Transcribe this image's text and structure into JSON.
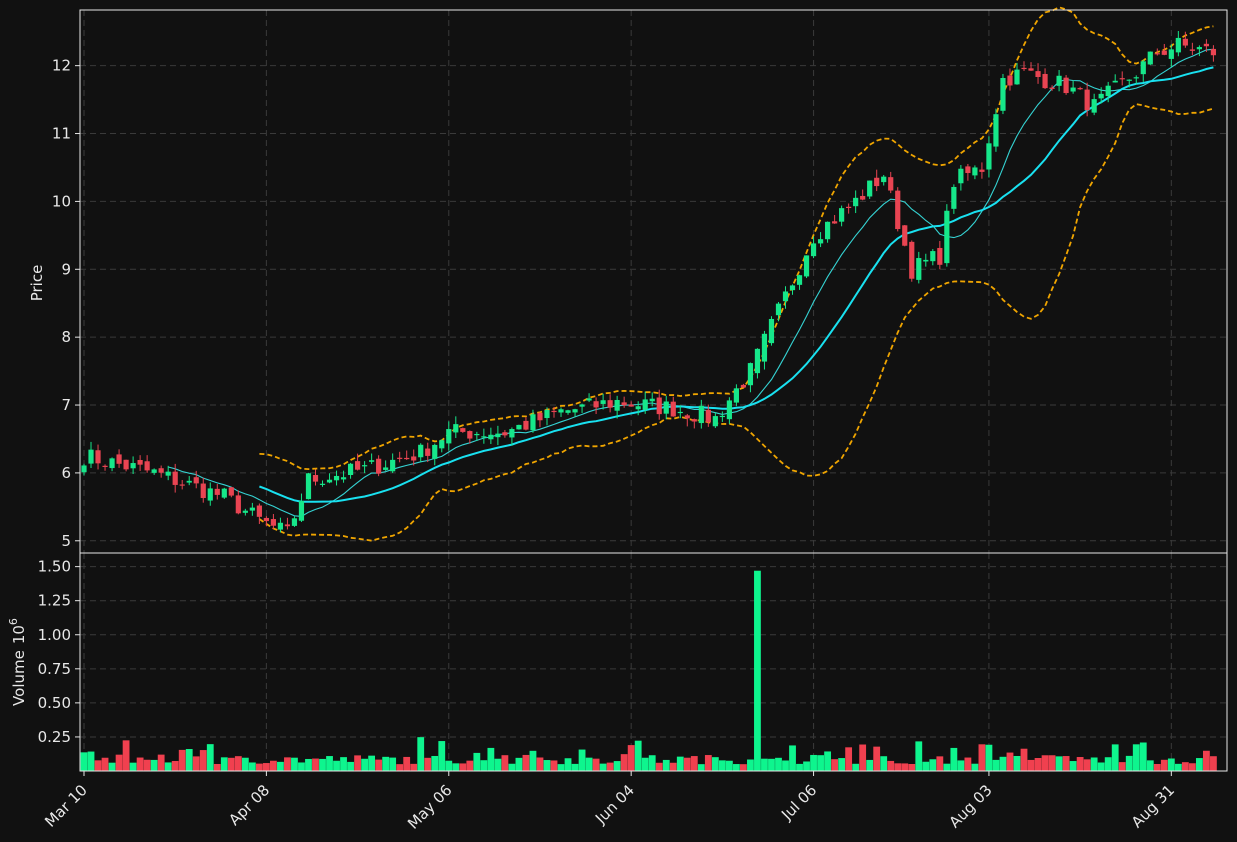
{
  "chart_data": {
    "type": "candlestick",
    "n_bars": 162,
    "x_ticks": [
      {
        "index": 0,
        "label": "Mar 10"
      },
      {
        "index": 26,
        "label": "Apr 08"
      },
      {
        "index": 52,
        "label": "May 06"
      },
      {
        "index": 78,
        "label": "Jun 04"
      },
      {
        "index": 104,
        "label": "Jul 06"
      },
      {
        "index": 129,
        "label": "Aug 03"
      },
      {
        "index": 155,
        "label": "Aug 31"
      }
    ],
    "price_panel": {
      "ylabel": "Price",
      "ylim": [
        4.82,
        12.82
      ],
      "yticks": [
        5,
        6,
        7,
        8,
        9,
        10,
        11,
        12
      ]
    },
    "volume_panel": {
      "ylabel": "Volume",
      "yunit": "10",
      "yunit_exp": "6",
      "ylim": [
        0,
        1.6
      ],
      "yticks": [
        0.25,
        0.5,
        0.75,
        1.0,
        1.25,
        1.5
      ],
      "ytick_labels": [
        "0.25",
        "0.50",
        "0.75",
        "1.00",
        "1.25",
        "1.50"
      ]
    },
    "price_anchors": [
      [
        0,
        6.25
      ],
      [
        10,
        6.0
      ],
      [
        20,
        5.65
      ],
      [
        25,
        5.3
      ],
      [
        29,
        5.1
      ],
      [
        32,
        5.9
      ],
      [
        40,
        6.05
      ],
      [
        48,
        6.3
      ],
      [
        52,
        6.6
      ],
      [
        60,
        6.6
      ],
      [
        68,
        6.9
      ],
      [
        76,
        7.05
      ],
      [
        84,
        6.95
      ],
      [
        90,
        6.8
      ],
      [
        95,
        7.5
      ],
      [
        100,
        8.6
      ],
      [
        104,
        9.5
      ],
      [
        110,
        10.0
      ],
      [
        114,
        10.4
      ],
      [
        118,
        9.0
      ],
      [
        122,
        9.2
      ],
      [
        124,
        10.3
      ],
      [
        128,
        10.5
      ],
      [
        131,
        11.8
      ],
      [
        134,
        11.9
      ],
      [
        140,
        11.7
      ],
      [
        144,
        11.4
      ],
      [
        150,
        11.9
      ],
      [
        153,
        12.2
      ],
      [
        156,
        12.3
      ],
      [
        161,
        12.2
      ]
    ],
    "series": [
      {
        "name": "sma_fast",
        "color": "#35d3d3",
        "window": 10,
        "start": 12
      },
      {
        "name": "sma_slow",
        "color": "#19e1f0",
        "window": 20,
        "start": 25
      },
      {
        "name": "bb_upper",
        "color": "#f0a500",
        "start": 25
      },
      {
        "name": "bb_lower",
        "color": "#f0a500",
        "start": 25
      }
    ],
    "volume_spikes": [
      {
        "index": 96,
        "value": 1.47
      }
    ],
    "colors": {
      "up": "#16e78a",
      "down": "#e94452",
      "volume_up": "#0ef58e",
      "volume_down": "#f0404f",
      "background": "#111111",
      "frame": "#e6e6e6",
      "text": "#e8e8e8",
      "grid": "#3a3a3a"
    },
    "grid": true
  }
}
